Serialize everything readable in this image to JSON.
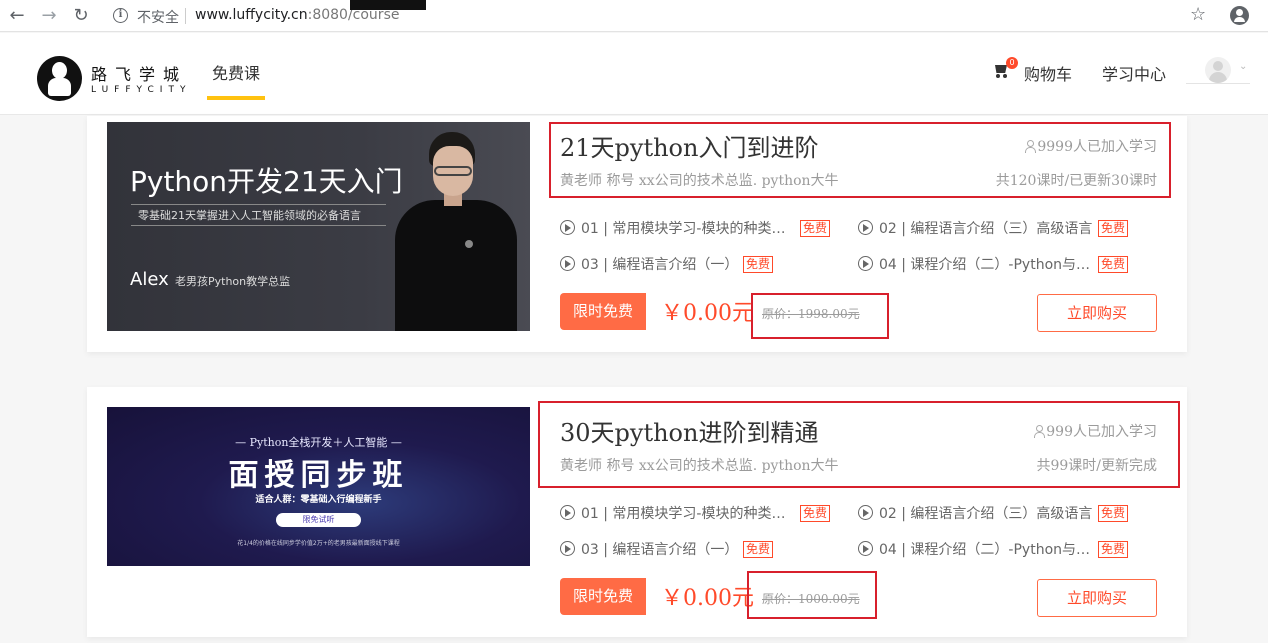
{
  "browser": {
    "security_label": "不安全",
    "url_host": "www.luffycity.cn",
    "url_rest": ":8080/course"
  },
  "site": {
    "logo_cn": "路飞学城",
    "logo_en": "LUFFYCITY",
    "nav_free": "免费课",
    "cart_count": "0",
    "cart_label": "购物车",
    "study_center": "学习中心"
  },
  "courses": [
    {
      "title": "21天python入门到进阶",
      "learners": "9999人已加入学习",
      "teacher": "黄老师 称号 xx公司的技术总监. python大牛",
      "lessons_info": "共120课时/已更新30课时",
      "thumb": {
        "title": "Python开发21天入门",
        "subtitle": "零基础21天掌握进入人工智能领域的必备语言",
        "name": "Alex",
        "role": "老男孩Python教学总监"
      },
      "lessons": [
        {
          "label": "01 | 常用模块学习-模块的种类…",
          "tag": "免费"
        },
        {
          "label": "02 | 编程语言介绍（三）高级语言",
          "tag": "免费"
        },
        {
          "label": "03 | 编程语言介绍（一）",
          "tag": "免费"
        },
        {
          "label": "04 | 课程介绍（二）-Python与…",
          "tag": "免费"
        }
      ],
      "promo": "限时免费",
      "price": "￥0.00元",
      "original_price": "原价：1998.00元",
      "buy": "立即购买"
    },
    {
      "title": "30天python进阶到精通",
      "learners": "999人已加入学习",
      "teacher": "黄老师 称号 xx公司的技术总监. python大牛",
      "lessons_info": "共99课时/更新完成",
      "thumb": {
        "top": "— Python全栈开发＋人工智能 —",
        "title": "面授同步班",
        "subtitle": "适合人群：零基础入行编程新手",
        "button": "限免试听",
        "fine": "花1/4的价格在线同步学价值2万+的老男孩最新面授线下课程"
      },
      "lessons": [
        {
          "label": "01 | 常用模块学习-模块的种类…",
          "tag": "免费"
        },
        {
          "label": "02 | 编程语言介绍（三）高级语言",
          "tag": "免费"
        },
        {
          "label": "03 | 编程语言介绍（一）",
          "tag": "免费"
        },
        {
          "label": "04 | 课程介绍（二）-Python与…",
          "tag": "免费"
        }
      ],
      "promo": "限时免费",
      "price": "￥0.00元",
      "original_price": "原价：1000.00元",
      "buy": "立即购买"
    }
  ],
  "colors": {
    "accent": "#ff4a2a",
    "promo_bg": "#ff6b45",
    "nav_underline": "#ffc210",
    "annotation_box": "#d8202c"
  }
}
